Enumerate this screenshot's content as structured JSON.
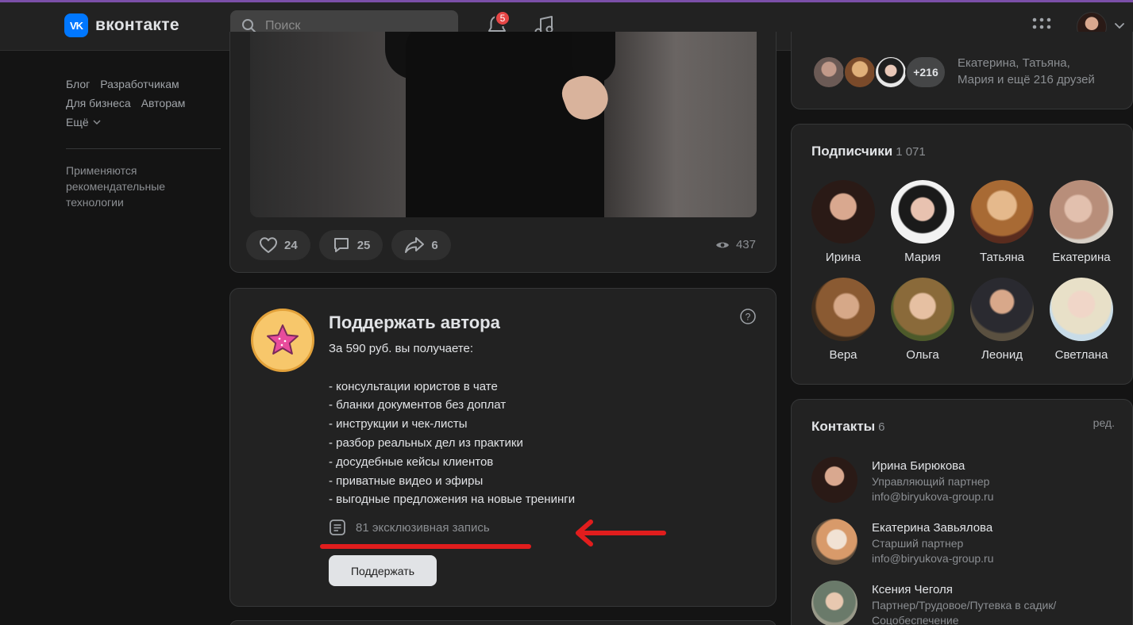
{
  "header": {
    "logo_mark": "VK",
    "logo_text": "вконтакте",
    "search_placeholder": "Поиск",
    "notifications_count": "5"
  },
  "left_nav": {
    "links_row1": [
      "Блог",
      "Разработчикам"
    ],
    "links_row2": [
      "Для бизнеса",
      "Авторам"
    ],
    "more_label": "Ещё",
    "note": "Применяются рекомендательные технологии"
  },
  "post": {
    "likes": "24",
    "comments": "25",
    "shares": "6",
    "views": "437"
  },
  "donut": {
    "title": "Поддержать автора",
    "text": "За 590 руб. вы получаете:\n\n- консультации юристов в чате\n- бланки документов без доплат\n- инструкции и чек-листы\n- разбор реальных дел из практики\n- досудебные кейсы клиентов\n- приватные видео и эфиры\n- выгодные предложения на новые тренинги",
    "exclusive": "81 эксклюзивная запись",
    "button": "Поддержать"
  },
  "friends": {
    "more": "+216",
    "text_line1": "Екатерина, Татьяна,",
    "text_line2": "Мария и ещё 216 друзей"
  },
  "subscribers": {
    "title": "Подписчики",
    "count": "1 071",
    "people": [
      "Ирина",
      "Мария",
      "Татьяна",
      "Екатерина",
      "Вера",
      "Ольга",
      "Леонид",
      "Светлана"
    ]
  },
  "contacts": {
    "title": "Контакты",
    "count": "6",
    "edit": "ред.",
    "items": [
      {
        "name": "Ирина Бирюкова",
        "role": "Управляющий партнер",
        "email": "info@biryukova-group.ru"
      },
      {
        "name": "Екатерина Завьялова",
        "role": "Старший партнер",
        "email": "info@biryukova-group.ru"
      },
      {
        "name": "Ксения Чеголя",
        "role": "Партнер/Трудовое/Путевка в садик/",
        "email": "Соцобеспечение"
      }
    ]
  },
  "colors": {
    "accent": "#0077ff",
    "background": "#141414",
    "card": "#222222",
    "annotation_red": "#e11d1d",
    "badge": "#e64646"
  }
}
